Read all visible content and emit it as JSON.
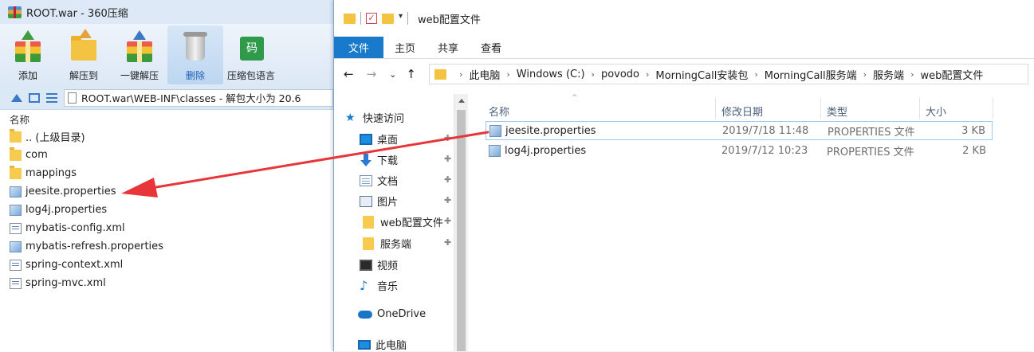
{
  "zip": {
    "title": "ROOT.war - 360压缩",
    "toolbar": [
      {
        "label": "添加",
        "icon": "archive-add-icon"
      },
      {
        "label": "解压到",
        "icon": "extract-to-icon"
      },
      {
        "label": "一键解压",
        "icon": "one-click-extract-icon"
      },
      {
        "label": "删除",
        "icon": "trash-icon"
      },
      {
        "label": "压缩包语言",
        "icon": "archive-language-icon"
      }
    ],
    "path": "ROOT.war\\WEB-INF\\classes - 解包大小为 20.6",
    "column_name": "名称",
    "files": [
      {
        "name": ".. (上级目录)",
        "type": "folder"
      },
      {
        "name": "com",
        "type": "folder"
      },
      {
        "name": "mappings",
        "type": "folder"
      },
      {
        "name": "jeesite.properties",
        "type": "properties"
      },
      {
        "name": "log4j.properties",
        "type": "properties"
      },
      {
        "name": "mybatis-config.xml",
        "type": "xml"
      },
      {
        "name": "mybatis-refresh.properties",
        "type": "properties"
      },
      {
        "name": "spring-context.xml",
        "type": "xml"
      },
      {
        "name": "spring-mvc.xml",
        "type": "xml"
      }
    ]
  },
  "explorer": {
    "title": "web配置文件",
    "ribbon_tabs": [
      "文件",
      "主页",
      "共享",
      "查看"
    ],
    "breadcrumbs": [
      "此电脑",
      "Windows (C:)",
      "povodo",
      "MorningCall安装包",
      "MorningCall服务端",
      "服务端",
      "web配置文件"
    ],
    "nav": {
      "quick_access": "快速访问",
      "items": [
        {
          "label": "桌面",
          "icon": "desktop-icon",
          "pinned": true
        },
        {
          "label": "下载",
          "icon": "download-icon",
          "pinned": true
        },
        {
          "label": "文档",
          "icon": "documents-icon",
          "pinned": true
        },
        {
          "label": "图片",
          "icon": "pictures-icon",
          "pinned": true
        },
        {
          "label": "web配置文件",
          "icon": "folder-icon",
          "pinned": true
        },
        {
          "label": "服务端",
          "icon": "folder-icon",
          "pinned": true
        },
        {
          "label": "视频",
          "icon": "videos-icon",
          "pinned": false
        },
        {
          "label": "音乐",
          "icon": "music-icon",
          "pinned": false
        }
      ],
      "onedrive": "OneDrive",
      "this_pc": "此电脑"
    },
    "columns": {
      "name": "名称",
      "date": "修改日期",
      "type": "类型",
      "size": "大小"
    },
    "files": [
      {
        "name": "jeesite.properties",
        "date": "2019/7/18 11:48",
        "type": "PROPERTIES 文件",
        "size": "3 KB"
      },
      {
        "name": "log4j.properties",
        "date": "2019/7/12 10:23",
        "type": "PROPERTIES 文件",
        "size": "2 KB"
      }
    ]
  },
  "colors": {
    "accent": "#1979ca",
    "arrow": "#e8353a"
  }
}
